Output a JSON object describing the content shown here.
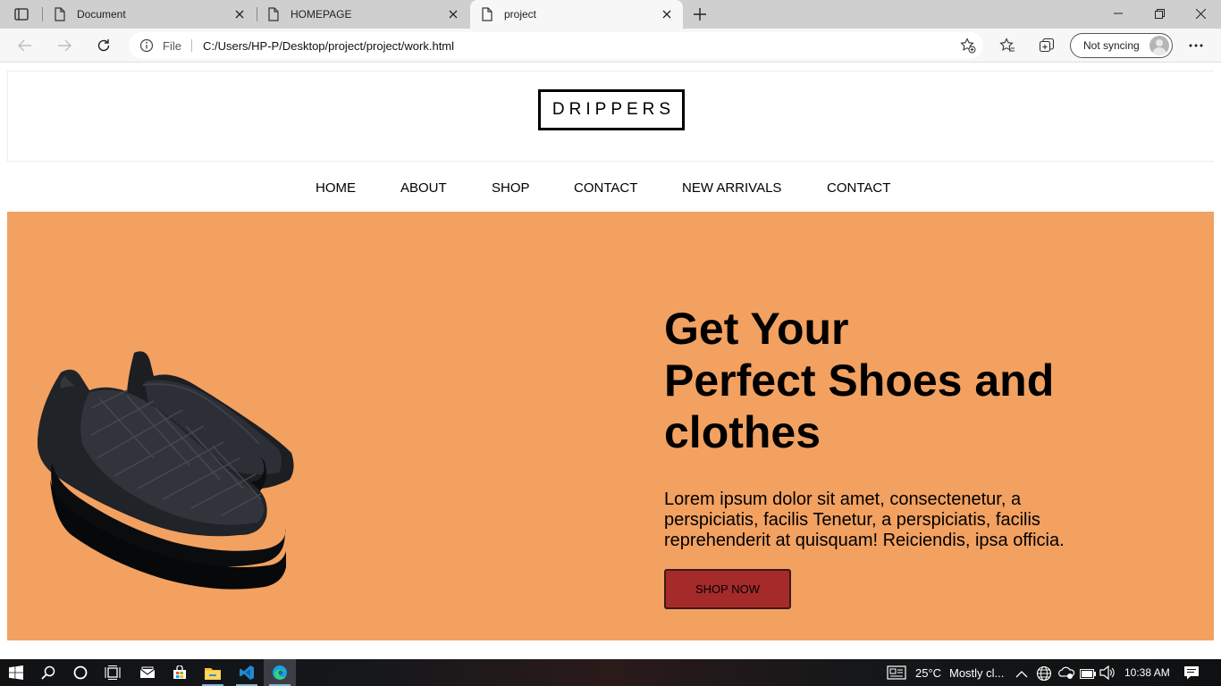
{
  "browser": {
    "tabs": [
      {
        "label": "Document",
        "active": false
      },
      {
        "label": "HOMEPAGE",
        "active": false
      },
      {
        "label": "project",
        "active": true
      }
    ],
    "address": {
      "scheme_label": "File",
      "url": "C:/Users/HP-P/Desktop/project/project/work.html"
    },
    "profile_label": "Not syncing"
  },
  "page": {
    "logo": "DRIPPERS",
    "nav": [
      "HOME",
      "ABOUT",
      "SHOP",
      "CONTACT",
      "NEW ARRIVALS",
      "CONTACT"
    ],
    "hero": {
      "title_lines": [
        "Get Your",
        "Perfect Shoes and",
        "clothes"
      ],
      "description": "Lorem ipsum dolor sit amet, consectenetur, a perspiciatis, facilis Tenetur, a perspiciatis, facilis reprehenderit at quisquam! Reiciendis, ipsa officia.",
      "button": "SHOP NOW"
    },
    "colors": {
      "hero_bg": "#f2a161",
      "button_bg": "#a52a2a"
    }
  },
  "taskbar": {
    "weather": "25°C",
    "weather_desc": "Mostly cl...",
    "time": "10:38 AM"
  }
}
